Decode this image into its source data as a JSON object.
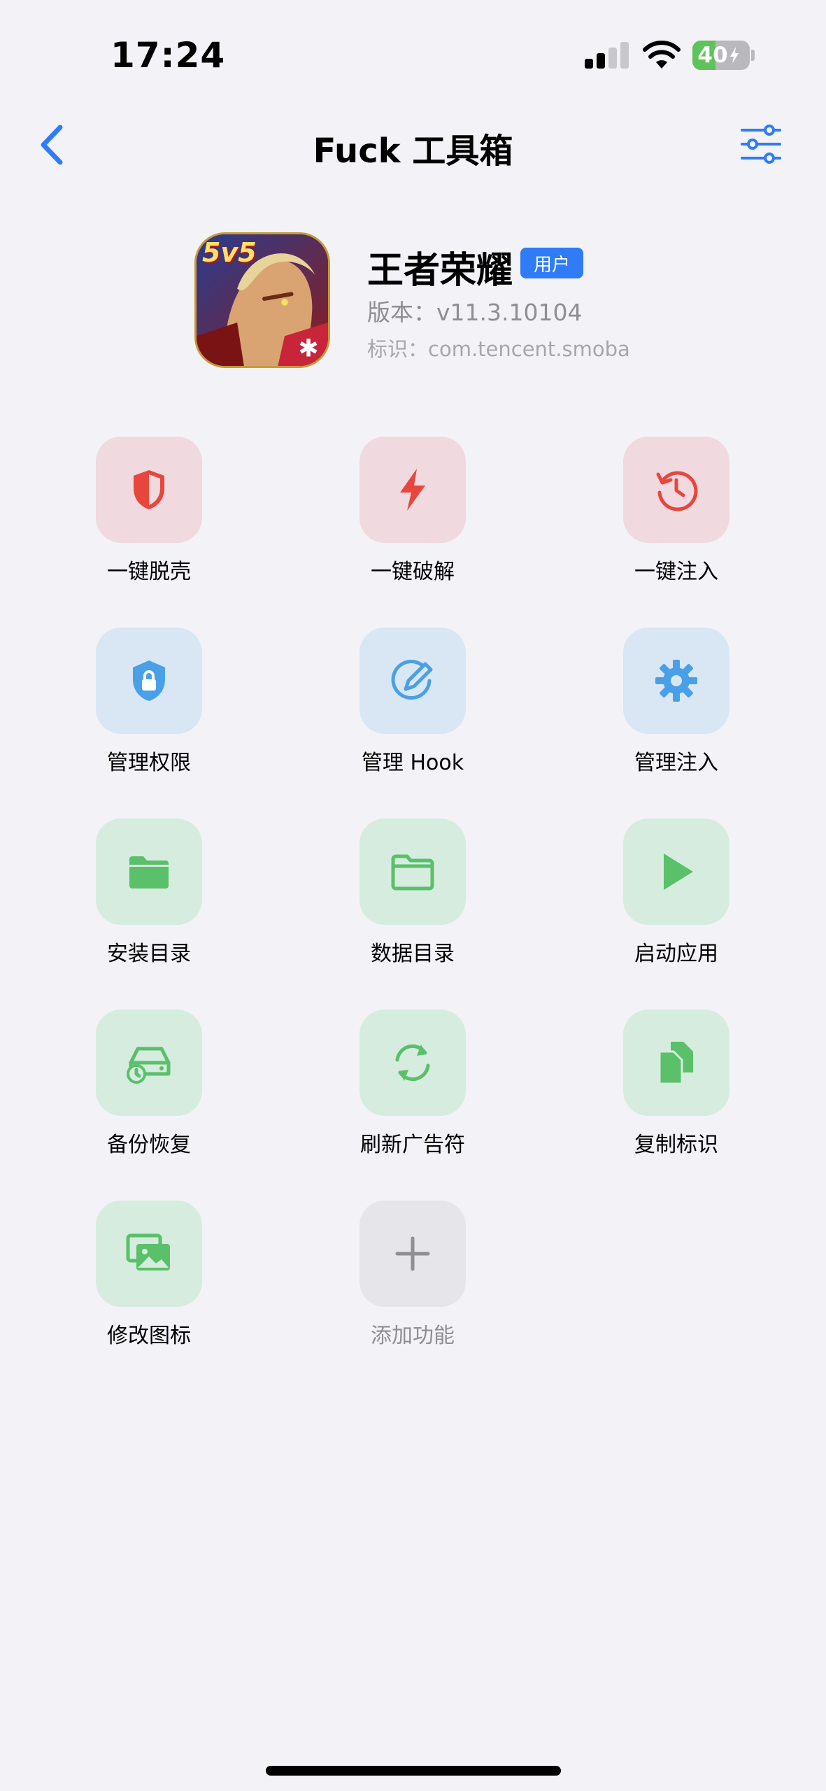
{
  "status_bar": {
    "time": "17:24",
    "battery_text": "40",
    "battery_level_percent": 40,
    "signal_bars_active": 2,
    "signal_bars_total": 4
  },
  "nav": {
    "title": "Fuck 工具箱",
    "back_icon": "chevron-left-icon",
    "settings_icon": "sliders-icon",
    "accent_color": "#2f7cf6"
  },
  "app": {
    "name": "王者荣耀",
    "badge": "用户",
    "version_label": "版本：",
    "version_value": "v11.3.10104",
    "id_label": "标识：",
    "id_value": "com.tencent.smoba",
    "icon_text": "5v5"
  },
  "colors": {
    "red_tile_bg": "#f0d9df",
    "red_icon": "#e8463c",
    "blue_tile_bg": "#d9e6f4",
    "blue_icon": "#4aa0e6",
    "green_tile_bg": "#d6ecdf",
    "green_icon": "#5ac06a",
    "gray_tile_bg": "#e5e5ea",
    "gray_icon": "#8e8e93"
  },
  "tools": [
    {
      "label": "一键脱壳",
      "icon": "shield-half-icon",
      "color": "red"
    },
    {
      "label": "一键破解",
      "icon": "lightning-icon",
      "color": "red"
    },
    {
      "label": "一键注入",
      "icon": "history-icon",
      "color": "red"
    },
    {
      "label": "管理权限",
      "icon": "shield-lock-icon",
      "color": "blue"
    },
    {
      "label": "管理 Hook",
      "icon": "edit-circle-icon",
      "color": "blue"
    },
    {
      "label": "管理注入",
      "icon": "gear-icon",
      "color": "blue"
    },
    {
      "label": "安装目录",
      "icon": "folder-filled-icon",
      "color": "green"
    },
    {
      "label": "数据目录",
      "icon": "folder-outline-icon",
      "color": "green"
    },
    {
      "label": "启动应用",
      "icon": "play-icon",
      "color": "green"
    },
    {
      "label": "备份恢复",
      "icon": "backup-drive-icon",
      "color": "green"
    },
    {
      "label": "刷新广告符",
      "icon": "refresh-icon",
      "color": "green"
    },
    {
      "label": "复制标识",
      "icon": "copy-doc-icon",
      "color": "green"
    },
    {
      "label": "修改图标",
      "icon": "photos-icon",
      "color": "green"
    },
    {
      "label": "添加功能",
      "icon": "plus-icon",
      "color": "gray"
    }
  ]
}
